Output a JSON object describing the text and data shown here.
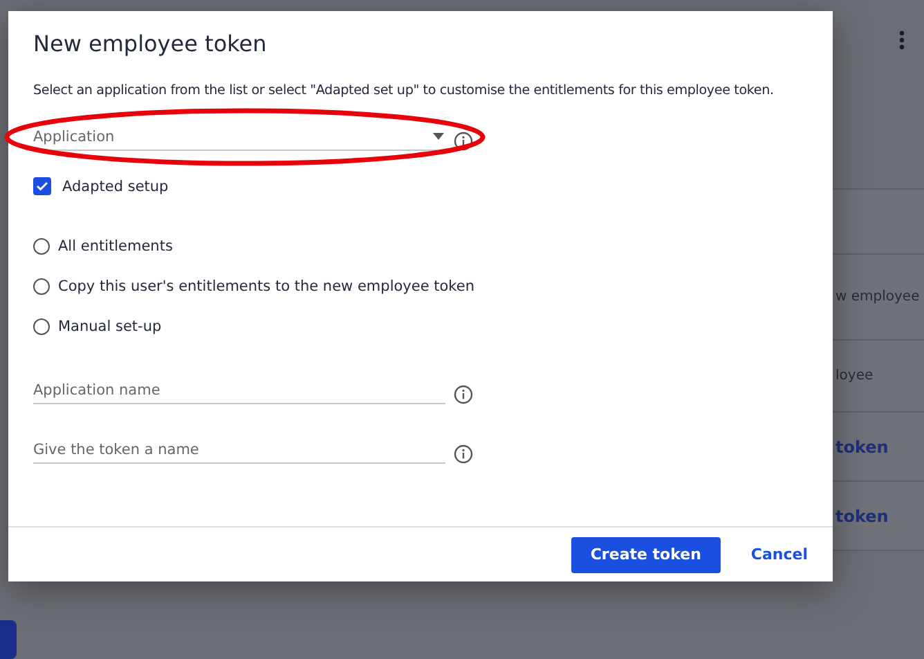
{
  "backdrop": {
    "row_texts": [
      "w employee",
      "loyee",
      "token",
      "token"
    ]
  },
  "dialog": {
    "title": "New employee token",
    "description": "Select an application from the list or select \"Adapted set up\" to customise the entitlements for this employee token.",
    "application_select": {
      "placeholder": "Application"
    },
    "adapted_setup": {
      "label": "Adapted setup",
      "checked": true
    },
    "options": [
      {
        "label": "All entitlements",
        "selected": false
      },
      {
        "label": "Copy this user's entitlements to the new employee token",
        "selected": false
      },
      {
        "label": "Manual set-up",
        "selected": false
      }
    ],
    "fields": [
      {
        "placeholder": "Application name"
      },
      {
        "placeholder": "Give the token a name"
      }
    ],
    "buttons": {
      "primary": "Create token",
      "secondary": "Cancel"
    }
  }
}
